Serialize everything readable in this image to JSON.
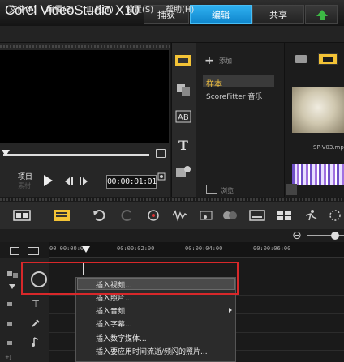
{
  "app": {
    "logo_text": "Corel VideoStudio X10"
  },
  "tabs": [
    {
      "label": "捕获"
    },
    {
      "label": "编辑"
    },
    {
      "label": "共享"
    }
  ],
  "menubar": [
    {
      "label": "文件(F)"
    },
    {
      "label": "编辑(E)"
    },
    {
      "label": "工具(T)"
    },
    {
      "label": "设置(S)"
    },
    {
      "label": "帮助(H)"
    }
  ],
  "player": {
    "project_label": "项目",
    "clip_label": "素材",
    "timecode": "00:00:01:01"
  },
  "library": {
    "add_label": "添加",
    "items": [
      {
        "label": "样本"
      },
      {
        "label": "ScoreFitter 音乐"
      }
    ],
    "browse_label": "浏览",
    "thumb_label": "SP-V03.mp"
  },
  "ruler": {
    "ticks": [
      "00:00:00:00",
      "00:00:02:00",
      "00:00:04:00",
      "00:00:06:00"
    ]
  },
  "context_menu": {
    "items": [
      {
        "label": "插入视频..."
      },
      {
        "label": "插入照片..."
      },
      {
        "label": "插入音频"
      },
      {
        "label": "插入字幕..."
      },
      {
        "label": "插入数字媒体..."
      },
      {
        "label": "插入要应用时间流逝/频闪的照片..."
      }
    ]
  },
  "bottom": {
    "label": "+J"
  },
  "colors": {
    "accent": "#1fa0e0",
    "highlight_box": "#d8282a",
    "library_selected": "#f0c040"
  }
}
